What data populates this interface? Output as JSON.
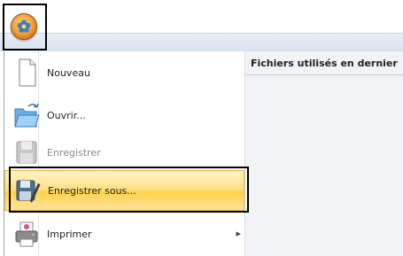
{
  "menu": {
    "items": [
      {
        "label": "Nouveau",
        "icon": "new-document-icon"
      },
      {
        "label": "Ouvrir...",
        "icon": "open-folder-icon"
      },
      {
        "label": "Enregistrer",
        "icon": "save-icon"
      },
      {
        "label": "Enregistrer sous...",
        "icon": "save-as-icon"
      },
      {
        "label": "Imprimer",
        "icon": "printer-icon"
      }
    ]
  },
  "recent": {
    "title": "Fichiers utilisés en dernier"
  },
  "colors": {
    "highlight": "#ffd24a",
    "frame": "#000000"
  }
}
